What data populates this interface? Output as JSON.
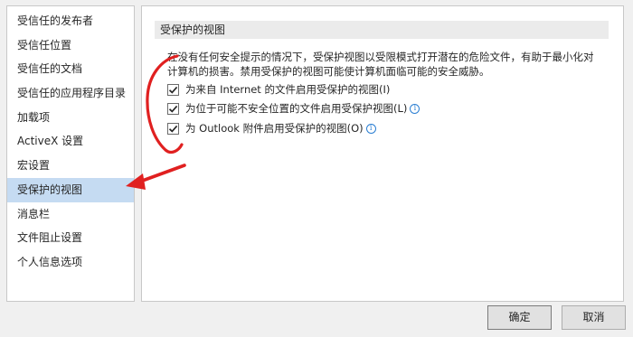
{
  "sidebar": {
    "items": [
      {
        "label": "受信任的发布者",
        "selected": false
      },
      {
        "label": "受信任位置",
        "selected": false
      },
      {
        "label": "受信任的文档",
        "selected": false
      },
      {
        "label": "受信任的应用程序目录",
        "selected": false
      },
      {
        "label": "加载项",
        "selected": false
      },
      {
        "label": "ActiveX 设置",
        "selected": false
      },
      {
        "label": "宏设置",
        "selected": false
      },
      {
        "label": "受保护的视图",
        "selected": true
      },
      {
        "label": "消息栏",
        "selected": false
      },
      {
        "label": "文件阻止设置",
        "selected": false
      },
      {
        "label": "个人信息选项",
        "selected": false
      }
    ]
  },
  "main": {
    "section_title": "受保护的视图",
    "description_line1": "在没有任何安全提示的情况下，受保护视图以受限模式打开潜在的危险文件，有助于最小化对",
    "description_line2": "计算机的损害。禁用受保护的视图可能使计算机面临可能的安全威胁。",
    "options": [
      {
        "label": "为来自 Internet 的文件启用受保护的视图(I)",
        "checked": true,
        "info": false
      },
      {
        "label": "为位于可能不安全位置的文件启用受保护视图(L)",
        "checked": true,
        "info": true
      },
      {
        "label": "为 Outlook 附件启用受保护的视图(O)",
        "checked": true,
        "info": true
      }
    ]
  },
  "footer": {
    "ok_label": "确定",
    "cancel_label": "取消"
  },
  "colors": {
    "selection": "#c5dbf2",
    "annotation": "#e02020",
    "info": "#2a7ed2"
  },
  "icons": {
    "info": "info-icon",
    "check": "check-icon"
  }
}
